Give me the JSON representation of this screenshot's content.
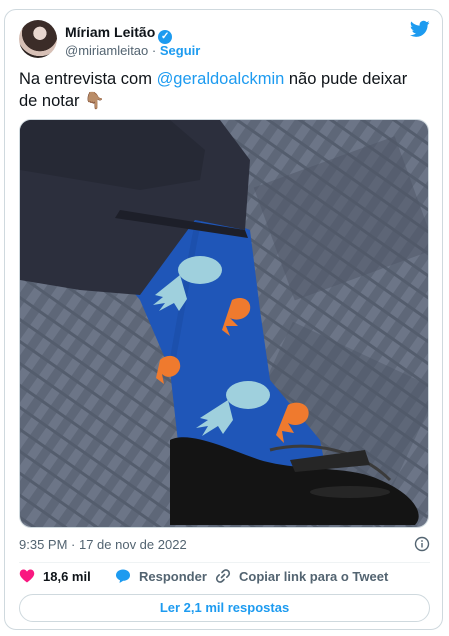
{
  "author": {
    "name": "Míriam Leitão",
    "handle": "@miriamleitao",
    "separator": "·",
    "follow_label": "Seguir"
  },
  "tweet": {
    "text_before": "Na entrevista com ",
    "mention": "@geraldoalckmin",
    "text_after": " não pude deixar de notar ",
    "emoji": "👇🏽"
  },
  "meta": {
    "time": "9:35 PM · 17 de nov de 2022"
  },
  "actions": {
    "likes": "18,6 mil",
    "reply_label": "Responder",
    "copy_label": "Copiar link para o Tweet"
  },
  "replies_button": "Ler 2,1 mil respostas",
  "colors": {
    "accent": "#1d9bf0",
    "like": "#f91880",
    "text": "#0f1419",
    "secondary": "#536471"
  },
  "icons": [
    "verified-badge-icon",
    "twitter-bird-icon",
    "info-icon",
    "heart-icon",
    "reply-bubble-icon",
    "link-icon"
  ]
}
